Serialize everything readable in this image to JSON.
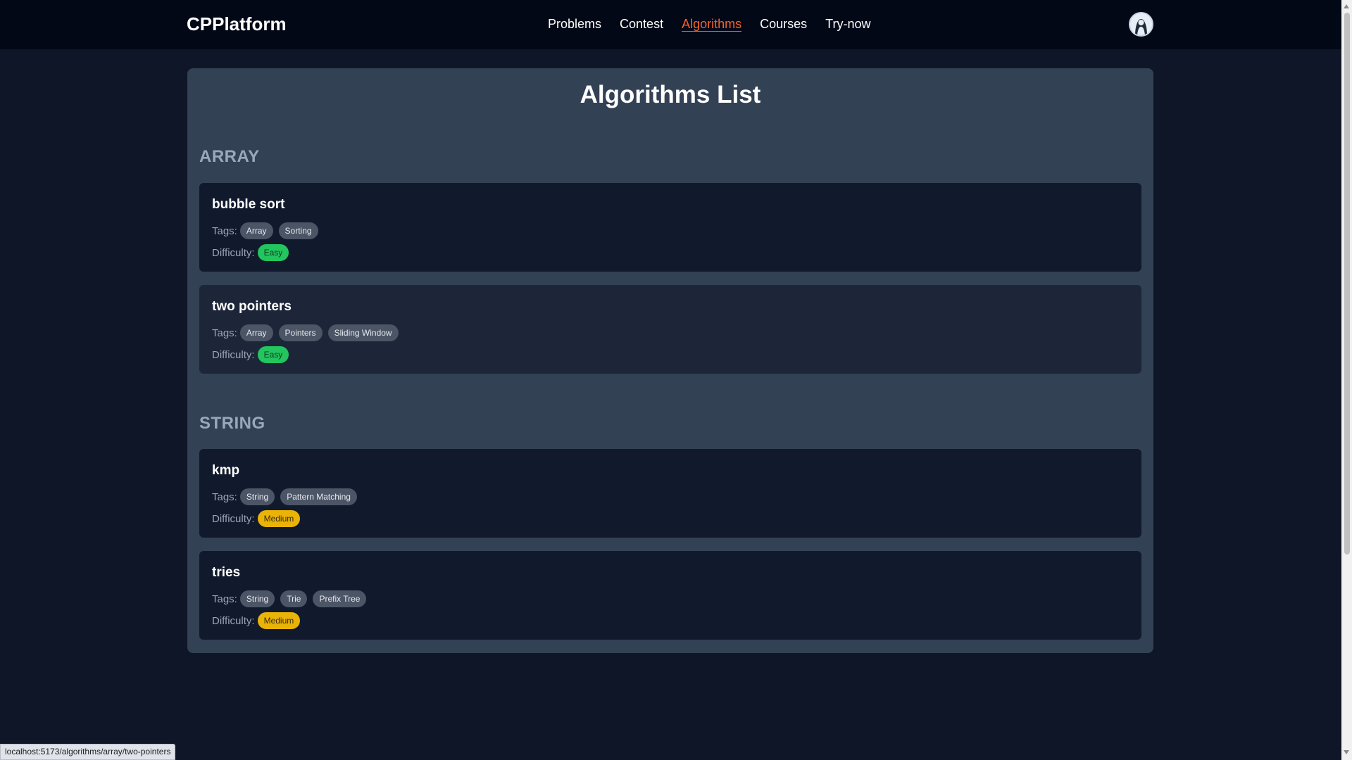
{
  "navbar": {
    "brand": "CPPlatform",
    "links": [
      "Problems",
      "Contest",
      "Algorithms",
      "Courses",
      "Try-now"
    ],
    "active_link": "Algorithms",
    "avatar_icon": "user-avatar-icon"
  },
  "page": {
    "title": "Algorithms List"
  },
  "sections": [
    {
      "title": "ARRAY",
      "items": [
        {
          "name": "bubble sort",
          "tags_label": "Tags:",
          "tags": [
            "Array",
            "Sorting"
          ],
          "difficulty_label": "Difficulty:",
          "difficulty": "Easy"
        },
        {
          "name": "two pointers",
          "tags_label": "Tags:",
          "tags": [
            "Array",
            "Pointers",
            "Sliding Window"
          ],
          "difficulty_label": "Difficulty:",
          "difficulty": "Easy"
        }
      ]
    },
    {
      "title": "STRING",
      "items": [
        {
          "name": "kmp",
          "tags_label": "Tags:",
          "tags": [
            "String",
            "Pattern Matching"
          ],
          "difficulty_label": "Difficulty:",
          "difficulty": "Medium"
        },
        {
          "name": "tries",
          "tags_label": "Tags:",
          "tags": [
            "String",
            "Trie",
            "Prefix Tree"
          ],
          "difficulty_label": "Difficulty:",
          "difficulty": "Medium"
        }
      ]
    }
  ],
  "status_bar": {
    "url": "localhost:5173/algorithms/array/two-pointers"
  },
  "colors": {
    "accent": "#f4622a",
    "easy": "#22c55e",
    "medium": "#eab308"
  }
}
